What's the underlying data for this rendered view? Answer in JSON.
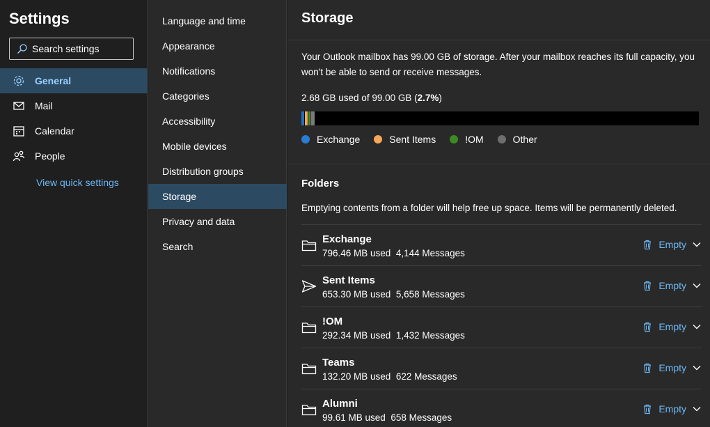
{
  "settings_title": "Settings",
  "search": {
    "placeholder": "Search settings",
    "icon": "search-icon"
  },
  "left_nav": [
    {
      "label": "General",
      "icon": "gear-icon",
      "active": true
    },
    {
      "label": "Mail",
      "icon": "mail-icon",
      "active": false
    },
    {
      "label": "Calendar",
      "icon": "calendar-icon",
      "active": false
    },
    {
      "label": "People",
      "icon": "people-icon",
      "active": false
    }
  ],
  "quick_settings": "View quick settings",
  "mid_nav": [
    {
      "label": "Language and time",
      "active": false
    },
    {
      "label": "Appearance",
      "active": false
    },
    {
      "label": "Notifications",
      "active": false
    },
    {
      "label": "Categories",
      "active": false
    },
    {
      "label": "Accessibility",
      "active": false
    },
    {
      "label": "Mobile devices",
      "active": false
    },
    {
      "label": "Distribution groups",
      "active": false
    },
    {
      "label": "Storage",
      "active": true
    },
    {
      "label": "Privacy and data",
      "active": false
    },
    {
      "label": "Search",
      "active": false
    }
  ],
  "storage": {
    "title": "Storage",
    "description": "Your Outlook mailbox has 99.00 GB of storage. After your mailbox reaches its full capacity, you won't be able to send or receive messages.",
    "used_prefix": "2.68 GB used of 99.00 GB (",
    "used_percent": "2.7%",
    "used_suffix": ")",
    "segments": [
      {
        "name": "Exchange",
        "fraction": 0.0078,
        "color": "#1f6fc2"
      },
      {
        "name": "Sent Items",
        "fraction": 0.0064,
        "color": "#f0a95a"
      },
      {
        "name": "!OM",
        "fraction": 0.0029,
        "color": "#4a9a2c"
      },
      {
        "name": "Other",
        "fraction": 0.0098,
        "color": "#7a7a7a"
      }
    ],
    "legend": [
      {
        "label": "Exchange",
        "color": "#2b7cd3"
      },
      {
        "label": "Sent Items",
        "color": "#f6a858"
      },
      {
        "label": "!OM",
        "color": "#3e8a22"
      },
      {
        "label": "Other",
        "color": "#6e6e6e"
      }
    ]
  },
  "folders": {
    "title": "Folders",
    "description": "Emptying contents from a folder will help free up space. Items will be permanently deleted.",
    "empty_label": "Empty",
    "items": [
      {
        "name": "Exchange",
        "size": "796.46 MB used",
        "messages": "4,144 Messages",
        "icon": "folder-icon"
      },
      {
        "name": "Sent Items",
        "size": "653.30 MB used",
        "messages": "5,658 Messages",
        "icon": "send-icon"
      },
      {
        "name": "!OM",
        "size": "292.34 MB used",
        "messages": "1,432 Messages",
        "icon": "folder-icon"
      },
      {
        "name": "Teams",
        "size": "132.20 MB used",
        "messages": "622 Messages",
        "icon": "folder-icon"
      },
      {
        "name": "Alumni",
        "size": "99.61 MB used",
        "messages": "658 Messages",
        "icon": "folder-icon"
      }
    ]
  }
}
